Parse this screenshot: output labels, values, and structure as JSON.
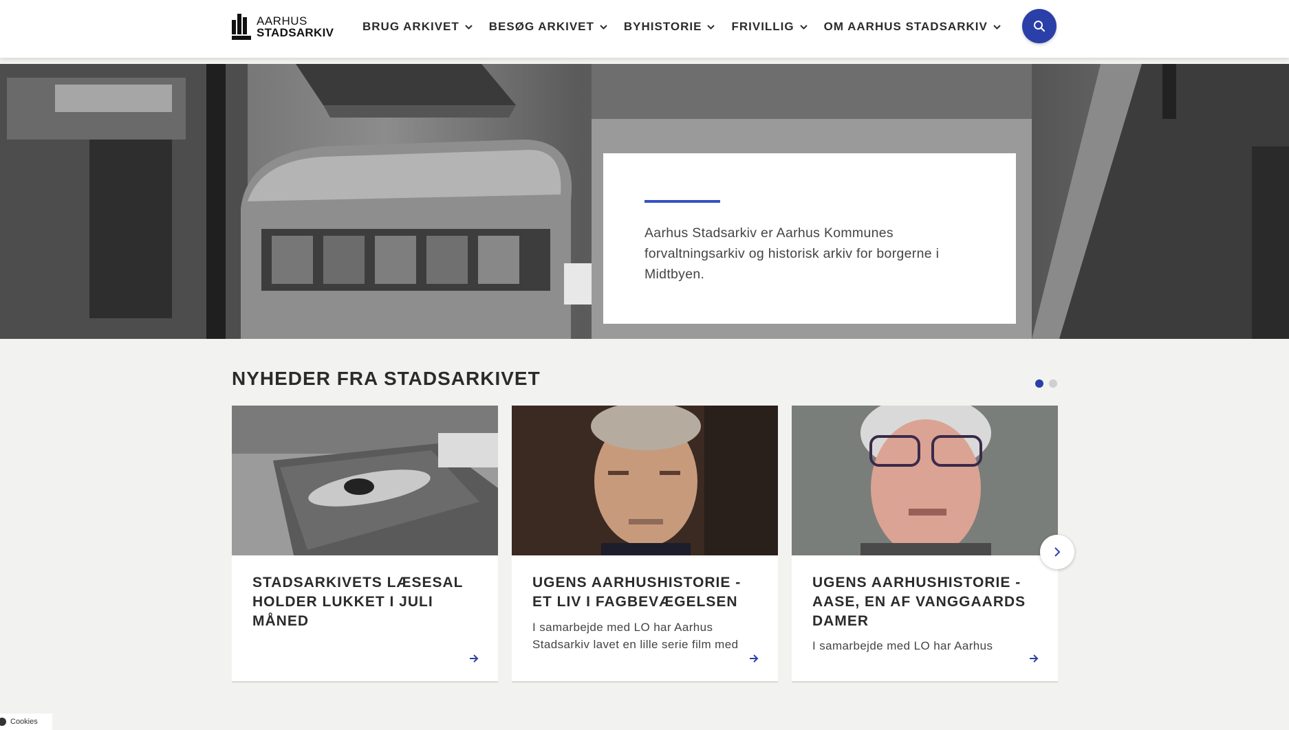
{
  "header": {
    "logo_line1": "AARHUS",
    "logo_line2": "STADSARKIV",
    "nav": [
      {
        "label": "BRUG ARKIVET"
      },
      {
        "label": "BESØG ARKIVET"
      },
      {
        "label": "BYHISTORIE"
      },
      {
        "label": "FRIVILLIG"
      },
      {
        "label": "OM AARHUS STADSARKIV"
      }
    ],
    "search_icon": "search-icon"
  },
  "hero": {
    "text": "Aarhus Stadsarkiv er Aarhus Kommunes forvaltningsarkiv og historisk arkiv for borgerne i Midtbyen."
  },
  "news": {
    "title": "NYHEDER FRA STADSARKIVET",
    "cards": [
      {
        "title": "STADSARKIVETS LÆSESAL HOLDER LUKKET I JULI MÅNED",
        "excerpt": ""
      },
      {
        "title": "UGENS AARHUSHISTORIE - ET LIV I FAGBEVÆGELSEN",
        "excerpt": "I samarbejde med LO har Aarhus Stadsarkiv lavet en lille serie film med"
      },
      {
        "title": "UGENS AARHUSHISTORIE - AASE, EN AF VANGGAARDS DAMER",
        "excerpt": "I samarbejde med LO har Aarhus"
      }
    ]
  },
  "cookie": {
    "label": "Cookies"
  },
  "colors": {
    "accent": "#2b3fa8",
    "accent_line": "#3550c3",
    "dot_active": "#2b3fa8",
    "dot_inactive": "#cfcfcf"
  }
}
